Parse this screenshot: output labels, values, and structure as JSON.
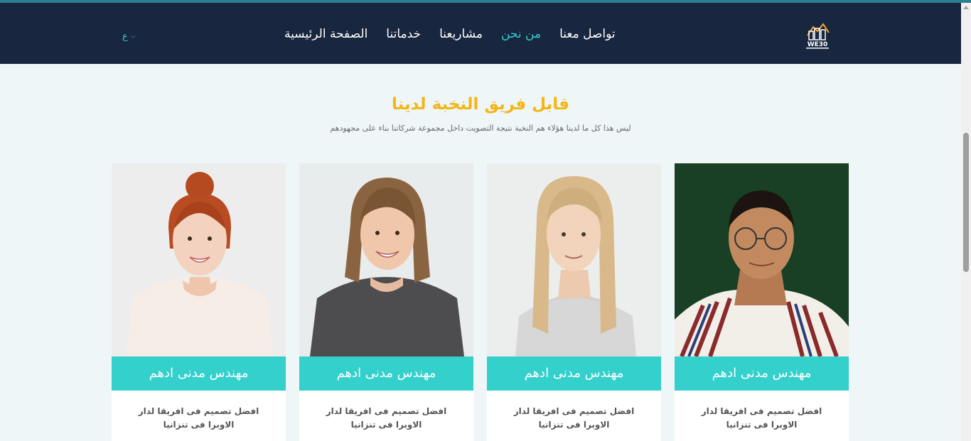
{
  "nav": {
    "logo_text": "WE30",
    "links": [
      "الصفحة الرئيسية",
      "خدماتنا",
      "مشاريعنا",
      "من نحن",
      "تواصل معنا"
    ],
    "active_index": 3,
    "language": "ع"
  },
  "section": {
    "title": "قابل فريق النخبة لدينا",
    "subtitle": "ليس هذا كل ما لدينا هؤلاء هم النخبة نتيجة التصويت داخل مجموعة شركاتنا بناء على مجهودهم"
  },
  "team": [
    {
      "name": "مهندس مدنى ادهم",
      "description": "افضل تصميم فى افريقا لدار الاوبرا فى تنزانيا",
      "photo": "man-with-glasses-photo"
    },
    {
      "name": "مهندس مدنى ادهم",
      "description": "افضل تصميم فى افريقا لدار الاوبرا فى تنزانيا",
      "photo": "blonde-woman-photo"
    },
    {
      "name": "مهندس مدنى ادهم",
      "description": "افضل تصميم فى افريقا لدار الاوبرا فى تنزانيا",
      "photo": "brunette-woman-photo"
    },
    {
      "name": "مهندس مدنى ادهم",
      "description": "افضل تصميم فى افريقا لدار الاوبرا فى تنزانيا",
      "photo": "redhead-woman-photo"
    }
  ],
  "colors": {
    "navbar": "#18263f",
    "accent": "#33d0cc",
    "title": "#f5b514",
    "page_bg": "#eef6f8"
  }
}
